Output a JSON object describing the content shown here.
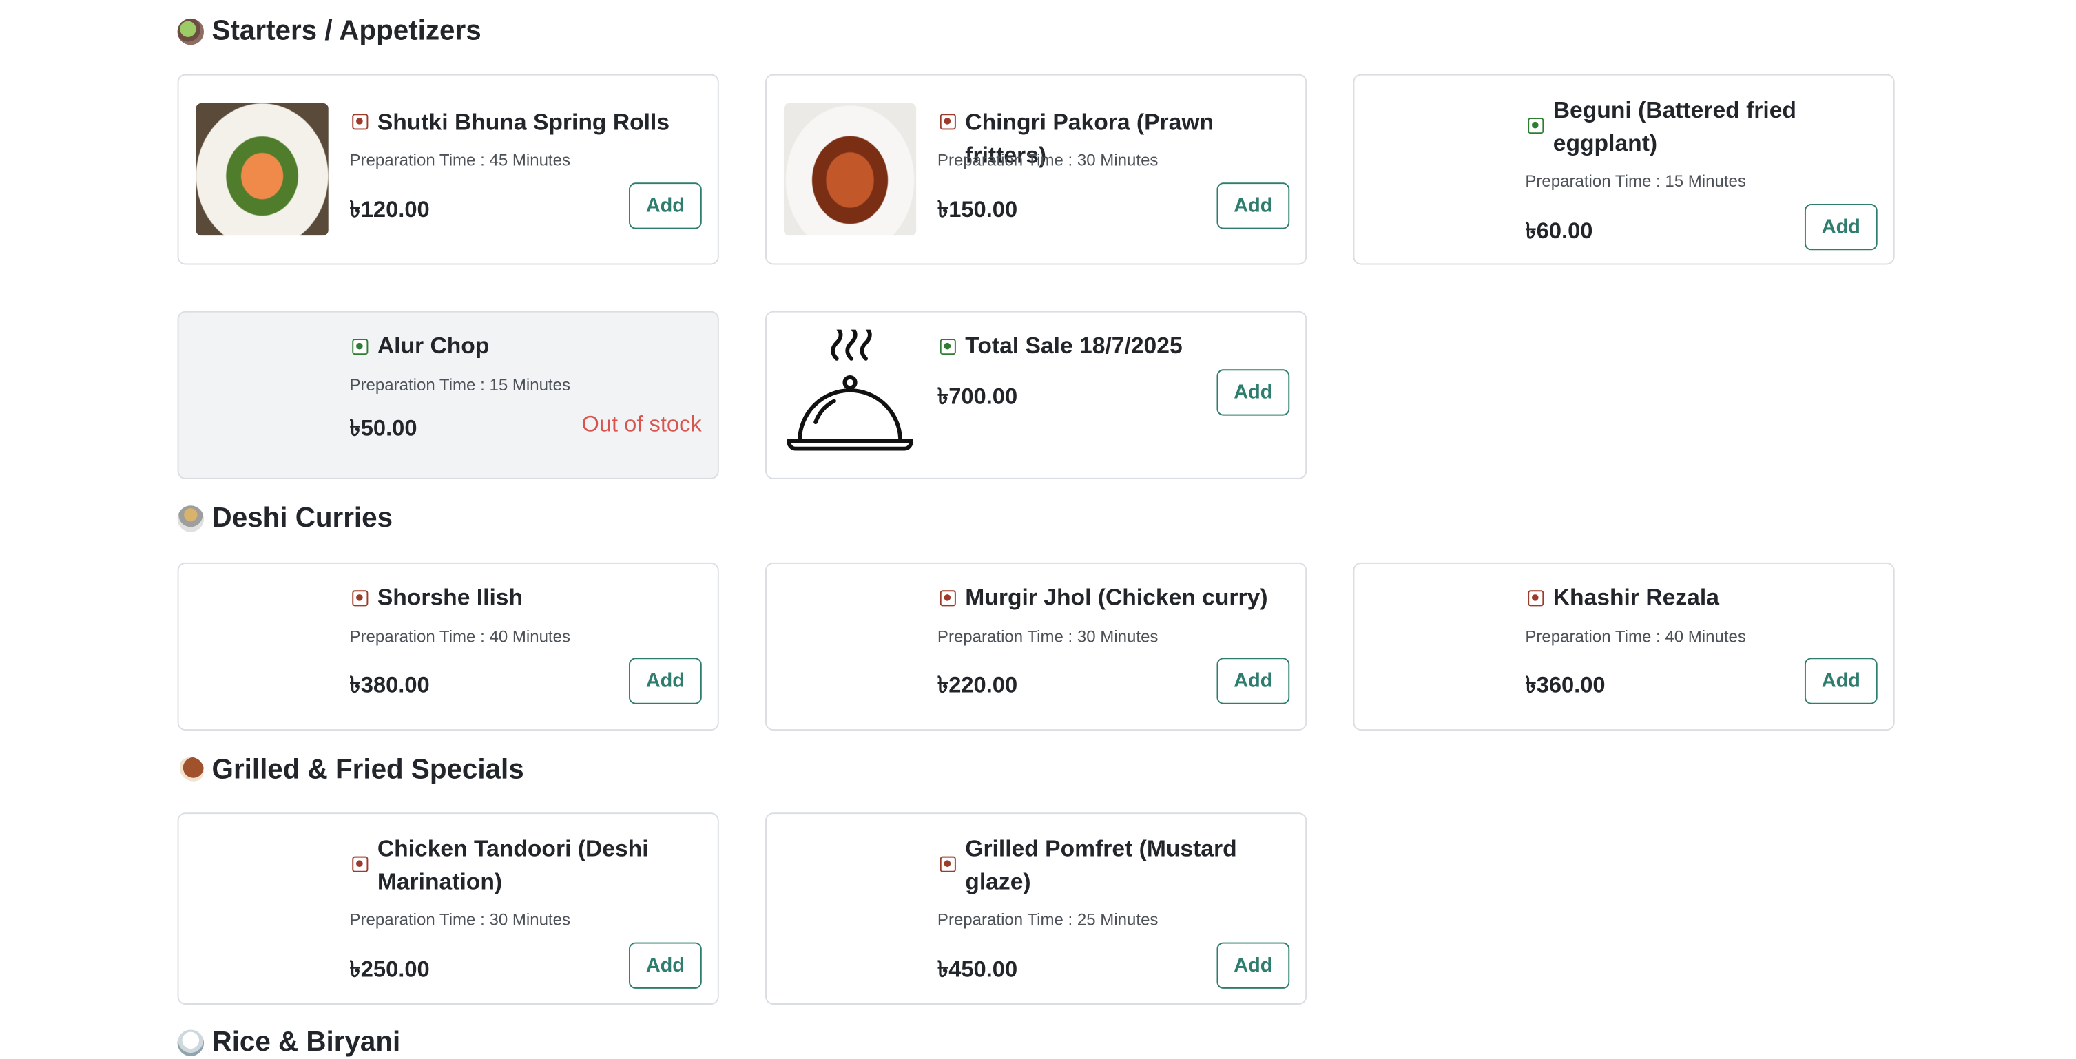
{
  "sections": [
    {
      "title": "Starters / Appetizers",
      "icon": "salad-icon"
    },
    {
      "title": "Deshi Curries",
      "icon": "curry-bowl-icon"
    },
    {
      "title": "Grilled & Fried Specials",
      "icon": "drumstick-icon"
    },
    {
      "title": "Rice & Biryani",
      "icon": "rice-icon"
    }
  ],
  "items": [
    {
      "name": "Shutki Bhuna Spring Rolls",
      "prep": "Preparation Time : 45 Minutes",
      "price": "৳120.00",
      "action": "Add",
      "diet": "non-veg"
    },
    {
      "name": "Chingri Pakora (Prawn fritters)",
      "prep": "Preparation Time : 30 Minutes",
      "price": "৳150.00",
      "action": "Add",
      "diet": "non-veg"
    },
    {
      "name": "Beguni (Battered fried eggplant)",
      "prep": "Preparation Time : 15 Minutes",
      "price": "৳60.00",
      "action": "Add",
      "diet": "veg"
    },
    {
      "name": "Alur Chop",
      "prep": "Preparation Time : 15 Minutes",
      "price": "৳50.00",
      "status": "Out of stock",
      "diet": "veg"
    },
    {
      "name": "Total Sale 18/7/2025",
      "price": "৳700.00",
      "action": "Add",
      "diet": "veg",
      "image": "cloche-icon"
    },
    {
      "name": "Shorshe Ilish",
      "prep": "Preparation Time : 40 Minutes",
      "price": "৳380.00",
      "action": "Add",
      "diet": "non-veg"
    },
    {
      "name": "Murgir Jhol (Chicken curry)",
      "prep": "Preparation Time : 30 Minutes",
      "price": "৳220.00",
      "action": "Add",
      "diet": "non-veg"
    },
    {
      "name": "Khashir Rezala",
      "prep": "Preparation Time : 40 Minutes",
      "price": "৳360.00",
      "action": "Add",
      "diet": "non-veg"
    },
    {
      "name": "Chicken Tandoori (Deshi Marination)",
      "prep": "Preparation Time : 30 Minutes",
      "price": "৳250.00",
      "action": "Add",
      "diet": "non-veg"
    },
    {
      "name": "Grilled Pomfret (Mustard glaze)",
      "prep": "Preparation Time : 25 Minutes",
      "price": "৳450.00",
      "action": "Add",
      "diet": "non-veg"
    }
  ],
  "colors": {
    "accent": "#2e7d6f",
    "out_of_stock": "#d9534f",
    "veg": "#2e7d32",
    "non_veg": "#9b3b2a",
    "card_border": "#dadde2",
    "card_disabled_bg": "#f2f3f5"
  }
}
